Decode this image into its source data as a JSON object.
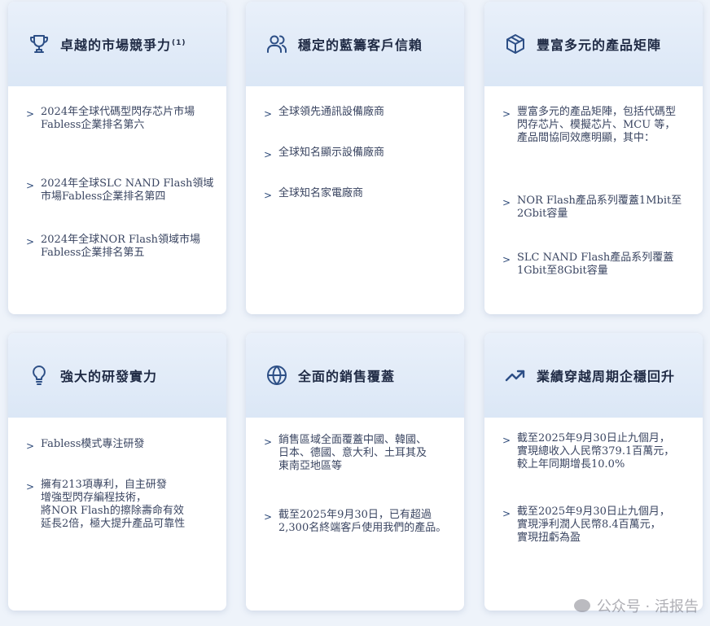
{
  "cards": [
    {
      "title": "卓越的市場競爭力",
      "sup": "(1)",
      "icon": "trophy-icon",
      "items": [
        "2024年全球代碼型閃存芯片市場\nFabless企業排名第六",
        "2024年全球SLC NAND Flash領域\n市場Fabless企業排名第四",
        "2024年全球NOR Flash領域市場\nFabless企業排名第五"
      ]
    },
    {
      "title": "穩定的藍籌客戶信賴",
      "icon": "users-icon",
      "items": [
        "全球領先通訊設備廠商",
        "全球知名顯示設備廠商",
        "全球知名家電廠商"
      ]
    },
    {
      "title": "豐富多元的產品矩陣",
      "icon": "cube-icon",
      "items": [
        "豐富多元的產品矩陣，包括代碼型\n閃存芯片、模擬芯片、MCU 等，\n產品間協同效應明顯，其中：",
        "NOR Flash產品系列覆蓋1Mbit至\n2Gbit容量",
        "SLC NAND Flash產品系列覆蓋\n1Gbit至8Gbit容量"
      ]
    },
    {
      "title": "強大的研發實力",
      "icon": "lightbulb-icon",
      "items": [
        "Fabless模式專注研發",
        "擁有213項專利，自主研發\n增強型閃存編程技術，\n將NOR Flash的擦除壽命有效\n延長2倍，極大提升產品可靠性"
      ]
    },
    {
      "title": "全面的銷售覆蓋",
      "icon": "globe-icon",
      "items": [
        "銷售區域全面覆蓋中國、韓國、\n日本、德國、意大利、土耳其及\n東南亞地區等",
        "截至2025年9月30日，已有超過\n2,300名終端客戶使用我們的產品。"
      ]
    },
    {
      "title": "業績穿越周期企穩回升",
      "icon": "trend-up-icon",
      "items": [
        "截至2025年9月30日止九個月，\n實現總收入人民幣379.1百萬元，\n較上年同期增長10.0%",
        "截至2025年9月30日止九個月，\n實現淨利潤人民幣8.4百萬元，\n實現扭虧為盈"
      ]
    }
  ],
  "watermark": "公众号 · 活报告"
}
